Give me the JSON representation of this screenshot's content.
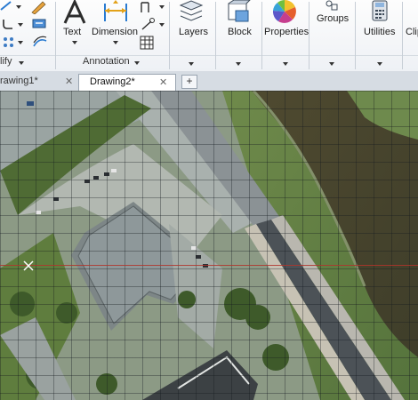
{
  "ribbon": {
    "modify_label": "lify",
    "annotation": {
      "title": "Annotation",
      "text_label": "Text",
      "dimension_label": "Dimension"
    },
    "layers_label": "Layers",
    "block_label": "Block",
    "properties_label": "Properties",
    "groups_label": "Groups",
    "utilities_label": "Utilities",
    "clipboard_label": "Clip"
  },
  "tabs": [
    {
      "label": "rawing1*",
      "active": false
    },
    {
      "label": "Drawing2*",
      "active": true
    }
  ],
  "new_tab_label": "+",
  "tab_close_glyph": "✕",
  "colors": {
    "ribbon_bg": "#f4f6f9",
    "grid_line": "#1e2226",
    "crosshair": "#b0342c",
    "active_tab_bg": "#ffffff"
  }
}
